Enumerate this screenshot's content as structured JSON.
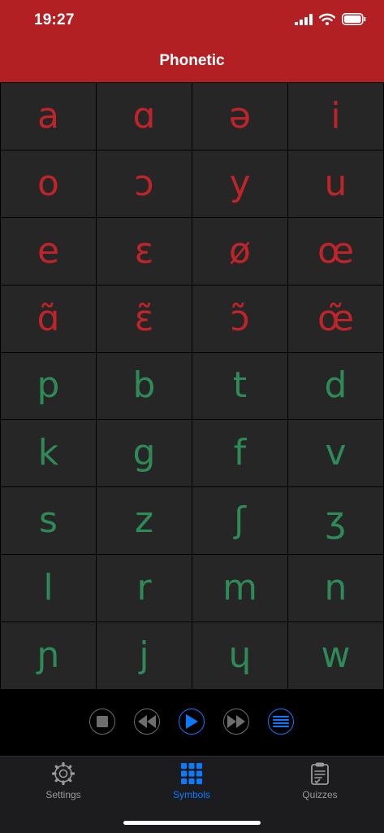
{
  "status_bar": {
    "time": "19:27"
  },
  "header": {
    "title": "Phonetic"
  },
  "colors": {
    "header_bg": "#b32024",
    "vowel": "#c0242b",
    "consonant": "#2e8b57",
    "accent": "#0a7aff",
    "control_gray": "#6e6e6e"
  },
  "symbols": {
    "vowels": [
      "a",
      "ɑ",
      "ə",
      "i",
      "o",
      "ɔ",
      "y",
      "u",
      "e",
      "ɛ",
      "ø",
      "œ",
      "ɑ̃",
      "ɛ̃",
      "ɔ̃",
      "œ̃"
    ],
    "consonants": [
      "p",
      "b",
      "t",
      "d",
      "k",
      "g",
      "f",
      "v",
      "s",
      "z",
      "ʃ",
      "ʒ",
      "l",
      "r",
      "m",
      "n",
      "ɲ",
      "j",
      "ɥ",
      "w"
    ]
  },
  "controls": [
    {
      "name": "stop",
      "active": false
    },
    {
      "name": "previous",
      "active": false
    },
    {
      "name": "play",
      "active": true
    },
    {
      "name": "next",
      "active": false
    },
    {
      "name": "list",
      "active": true
    }
  ],
  "tabs": [
    {
      "label": "Settings",
      "icon": "gear-icon",
      "active": false
    },
    {
      "label": "Symbols",
      "icon": "grid-icon",
      "active": true
    },
    {
      "label": "Quizzes",
      "icon": "clipboard-icon",
      "active": false
    }
  ]
}
